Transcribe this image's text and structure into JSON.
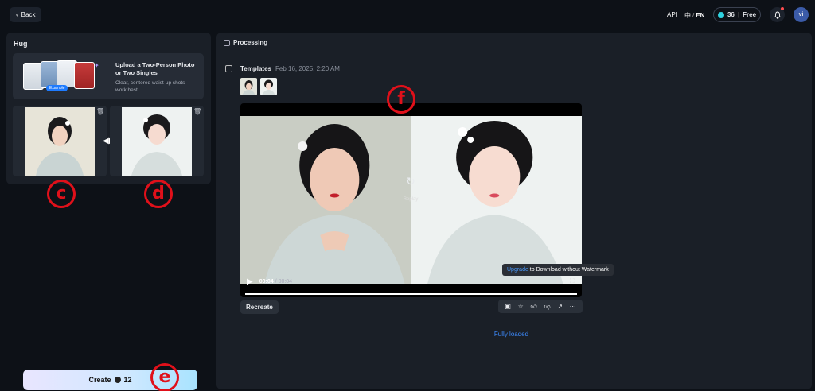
{
  "topbar": {
    "back_label": "Back",
    "api_label": "API",
    "lang_zh": "中",
    "lang_sep": "/",
    "lang_en": "EN",
    "credits_value": "36",
    "credits_sep": "|",
    "credits_plan": "Free",
    "avatar_initials": "vi"
  },
  "left": {
    "title": "Hug",
    "upload_heading": "Upload a Two-Person Photo or Two Singles",
    "upload_sub": "Clear, centered waist-up shots work best.",
    "example_badge": "Example"
  },
  "annotations": {
    "c": "c",
    "d": "d",
    "e": "e",
    "f": "f"
  },
  "create": {
    "label": "Create",
    "cost": "12"
  },
  "right": {
    "processing_label": "Processing",
    "templates_label": "Templates",
    "templates_date": "Feb 16, 2025, 2:20 AM",
    "replay_label": "Replay",
    "current_time": "00:04",
    "time_sep": "/",
    "duration": "00:04",
    "tooltip_link": "Upgrade",
    "tooltip_rest": " to Download without Watermark",
    "recreate_label": "Recreate",
    "fully_loaded": "Fully loaded"
  },
  "colors": {
    "accent_blue": "#3d8bff",
    "annotation_red": "#e0101a",
    "panel_bg": "#1a1f27",
    "page_bg": "#0d1117"
  }
}
